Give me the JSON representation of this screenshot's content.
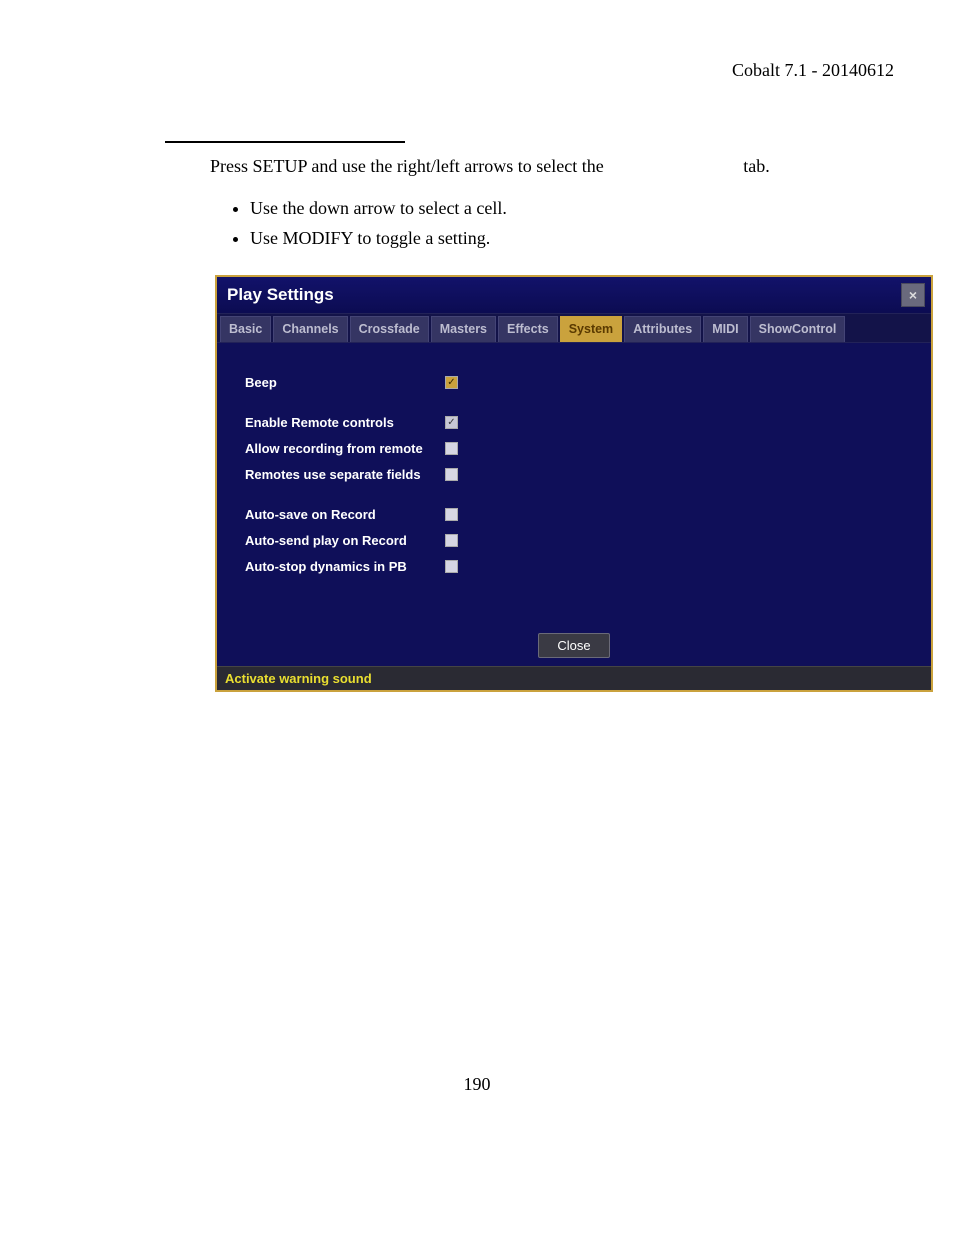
{
  "doc_header": "Cobalt 7.1 - 20140612",
  "intro_line": "Press SETUP and use the right/left arrows to select the",
  "intro_tail": "tab.",
  "bullets": [
    "Use the down arrow to select a cell.",
    "Use MODIFY to toggle a setting."
  ],
  "dialog": {
    "title": "Play Settings",
    "close_glyph": "×",
    "tabs": [
      "Basic",
      "Channels",
      "Crossfade",
      "Masters",
      "Effects",
      "System",
      "Attributes",
      "MIDI",
      "ShowControl"
    ],
    "active_tab": "System",
    "groups": [
      [
        {
          "label": "Beep",
          "checked": true,
          "style": "checked-yellow"
        }
      ],
      [
        {
          "label": "Enable Remote controls",
          "checked": true,
          "style": "checked-grey"
        },
        {
          "label": "Allow recording from remote",
          "checked": false,
          "style": "unchecked"
        },
        {
          "label": "Remotes use separate fields",
          "checked": false,
          "style": "unchecked"
        }
      ],
      [
        {
          "label": "Auto-save on Record",
          "checked": false,
          "style": "unchecked"
        },
        {
          "label": "Auto-send play on Record",
          "checked": false,
          "style": "unchecked"
        },
        {
          "label": "Auto-stop dynamics in PB",
          "checked": false,
          "style": "unchecked"
        }
      ]
    ],
    "close_button": "Close",
    "hint": "Activate warning sound"
  },
  "page_number": "190"
}
